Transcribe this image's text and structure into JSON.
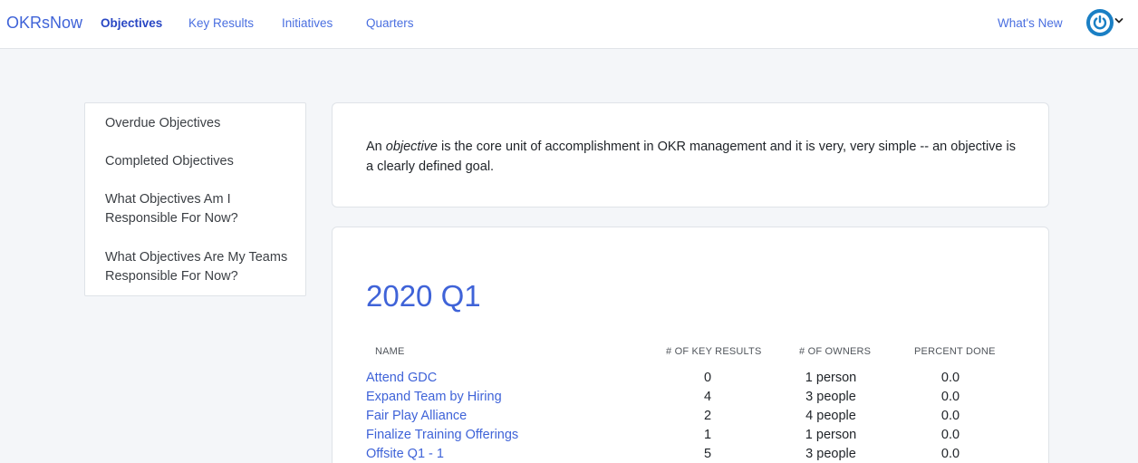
{
  "nav": {
    "brand": "OKRsNow",
    "links": [
      {
        "label": "Objectives",
        "active": true
      },
      {
        "label": "Key Results",
        "active": false
      },
      {
        "label": "Initiatives",
        "active": false
      },
      {
        "label": "Quarters",
        "active": false
      }
    ],
    "whats_new": "What's New",
    "avatar_icon": "power-icon",
    "menu_icon": "chevron-down-icon"
  },
  "sidebar": {
    "items": [
      {
        "label": "Overdue Objectives"
      },
      {
        "label": "Completed Objectives"
      },
      {
        "label": "What Objectives Am I Responsible For Now?"
      },
      {
        "label": "What Objectives Are My Teams Responsible For Now?"
      }
    ]
  },
  "intro": {
    "prefix": "An ",
    "emphasis": "objective",
    "rest": " is the core unit of accomplishment in OKR management and it is very, very simple -- an objective is a clearly defined goal."
  },
  "quarter": {
    "title": "2020 Q1",
    "columns": [
      "NAME",
      "# OF KEY RESULTS",
      "# OF OWNERS",
      "PERCENT DONE"
    ],
    "rows": [
      {
        "name": "Attend GDC",
        "key_results": "0",
        "owners": "1 person",
        "percent": "0.0"
      },
      {
        "name": "Expand Team by Hiring",
        "key_results": "4",
        "owners": "3 people",
        "percent": "0.0"
      },
      {
        "name": "Fair Play Alliance",
        "key_results": "2",
        "owners": "4 people",
        "percent": "0.0"
      },
      {
        "name": "Finalize Training Offerings",
        "key_results": "1",
        "owners": "1 person",
        "percent": "0.0"
      },
      {
        "name": "Offsite Q1 - 1",
        "key_results": "5",
        "owners": "3 people",
        "percent": "0.0"
      }
    ]
  },
  "colors": {
    "accent": "#3f63d8",
    "nav_active": "#2947c4",
    "avatar": "#1a7fc4",
    "background": "#f4f6f9"
  }
}
